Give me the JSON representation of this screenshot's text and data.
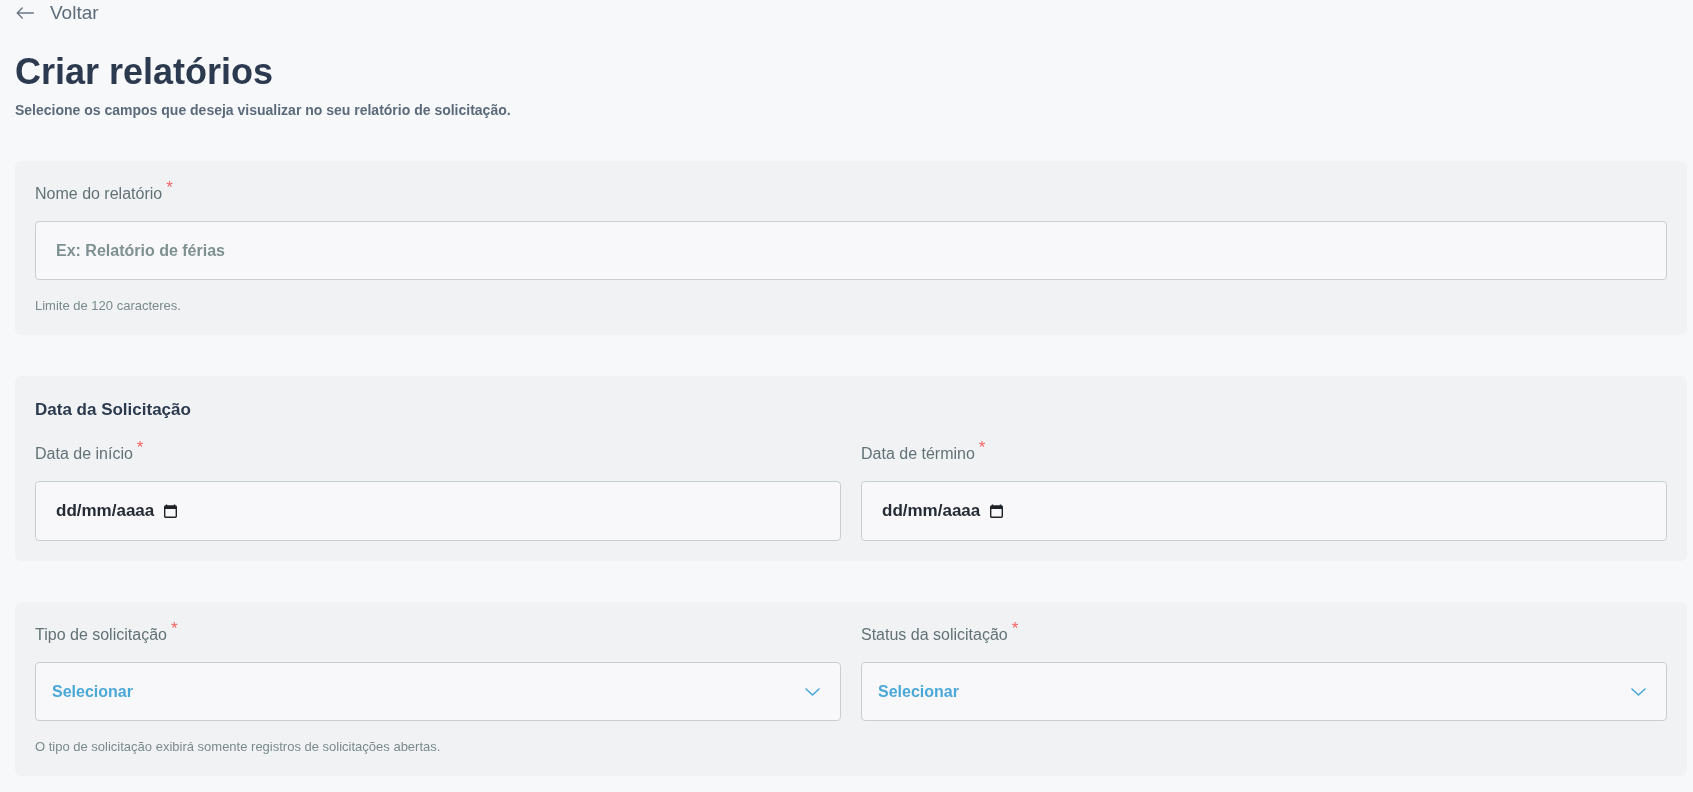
{
  "back_link": {
    "label": "Voltar"
  },
  "page": {
    "title": "Criar relatórios",
    "subtitle": "Selecione os campos que deseja visualizar no seu relatório de solicitação."
  },
  "sections": [
    {
      "fields": [
        {
          "kind": "text",
          "label": "Nome do relatório",
          "required_mark": "*",
          "placeholder": "Ex: Relatório de férias"
        }
      ],
      "hint": "Limite de 120 caracteres."
    },
    {
      "heading": "Data da Solicitação",
      "fields": [
        {
          "kind": "date",
          "label": "Data de início",
          "required_mark": "*",
          "placeholder": "dd/mm/aaaa"
        },
        {
          "kind": "date",
          "label": "Data de término",
          "required_mark": "*",
          "placeholder": "dd/mm/aaaa"
        }
      ]
    },
    {
      "fields": [
        {
          "kind": "select",
          "label": "Tipo de solicitação",
          "required_mark": "*",
          "placeholder": "Selecionar"
        },
        {
          "kind": "select",
          "label": "Status da solicitação",
          "required_mark": "*",
          "placeholder": "Selecionar"
        }
      ],
      "hint": "O tipo de solicitação exibirá somente registros de solicitações abertas."
    }
  ]
}
